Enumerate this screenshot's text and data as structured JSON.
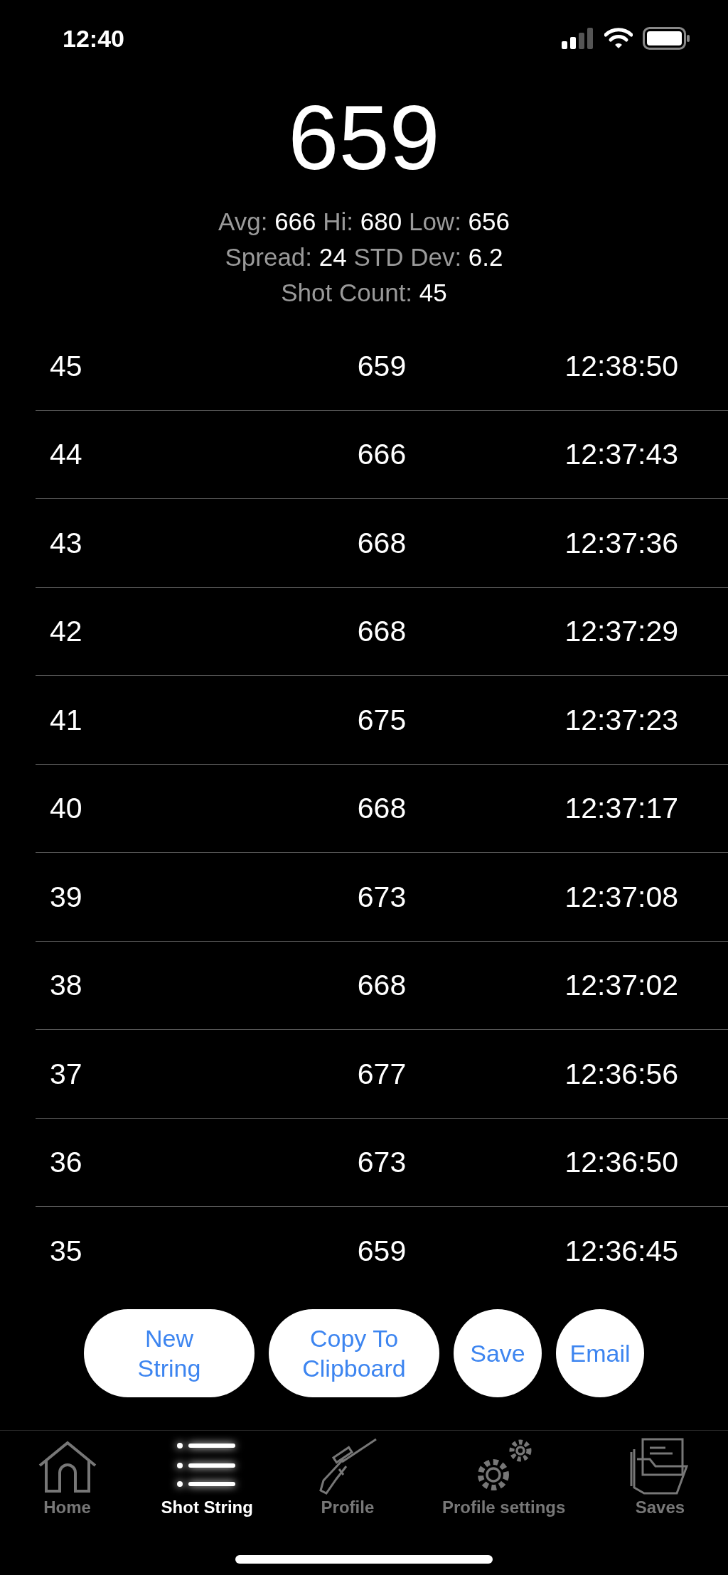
{
  "status_bar": {
    "time": "12:40"
  },
  "current_velocity": "659",
  "stats": [
    [
      {
        "label": "Avg:",
        "value": "666"
      },
      {
        "label": "Hi:",
        "value": "680"
      },
      {
        "label": "Low:",
        "value": "656"
      }
    ],
    [
      {
        "label": "Spread:",
        "value": "24"
      },
      {
        "label": "STD Dev:",
        "value": "6.2"
      }
    ],
    [
      {
        "label": "Shot Count:",
        "value": "45"
      }
    ]
  ],
  "shots": [
    {
      "number": "45",
      "velocity": "659",
      "time": "12:38:50"
    },
    {
      "number": "44",
      "velocity": "666",
      "time": "12:37:43"
    },
    {
      "number": "43",
      "velocity": "668",
      "time": "12:37:36"
    },
    {
      "number": "42",
      "velocity": "668",
      "time": "12:37:29"
    },
    {
      "number": "41",
      "velocity": "675",
      "time": "12:37:23"
    },
    {
      "number": "40",
      "velocity": "668",
      "time": "12:37:17"
    },
    {
      "number": "39",
      "velocity": "673",
      "time": "12:37:08"
    },
    {
      "number": "38",
      "velocity": "668",
      "time": "12:37:02"
    },
    {
      "number": "37",
      "velocity": "677",
      "time": "12:36:56"
    },
    {
      "number": "36",
      "velocity": "673",
      "time": "12:36:50"
    },
    {
      "number": "35",
      "velocity": "659",
      "time": "12:36:45"
    }
  ],
  "buttons": [
    {
      "kind": "pill",
      "label": "New String"
    },
    {
      "kind": "pill",
      "label": "Copy To Clipboard"
    },
    {
      "kind": "circle",
      "label": "Save"
    },
    {
      "kind": "circle",
      "label": "Email"
    }
  ],
  "tabs": [
    {
      "kind": "home",
      "label": "Home",
      "selected": false
    },
    {
      "kind": "list",
      "label": "Shot String",
      "selected": true
    },
    {
      "kind": "rifle",
      "label": "Profile",
      "selected": false
    },
    {
      "kind": "gears",
      "label": "Profile settings",
      "selected": false
    },
    {
      "kind": "folder",
      "label": "Saves",
      "selected": false
    }
  ]
}
